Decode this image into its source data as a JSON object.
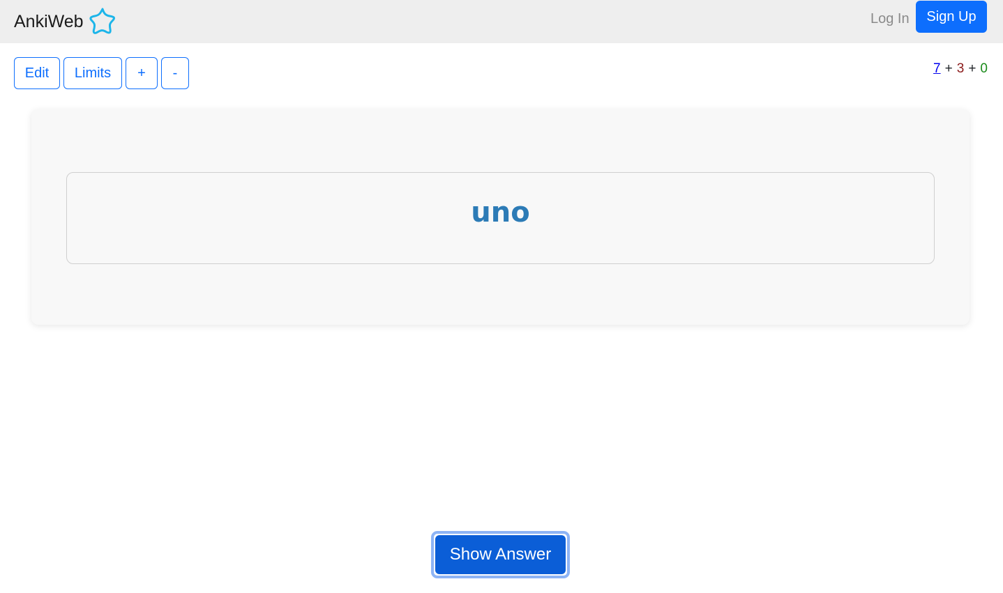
{
  "navbar": {
    "brand": "AnkiWeb",
    "brand_icon": "star-logo-icon",
    "login": "Log In",
    "signup": "Sign Up"
  },
  "toolbar": {
    "edit": "Edit",
    "limits": "Limits",
    "plus": "+",
    "minus": "-"
  },
  "counts": {
    "new": "7",
    "learning": "3",
    "review": "0",
    "separator": "+"
  },
  "card": {
    "front": "uno"
  },
  "actions": {
    "show_answer": "Show Answer"
  },
  "colors": {
    "primary": "#0d6efd",
    "navbar_bg": "#eeeeee",
    "card_text": "#2c7bb6",
    "new_count": "#0000ee",
    "learning_count": "#8b1a1a",
    "review_count": "#1a8a1a"
  }
}
